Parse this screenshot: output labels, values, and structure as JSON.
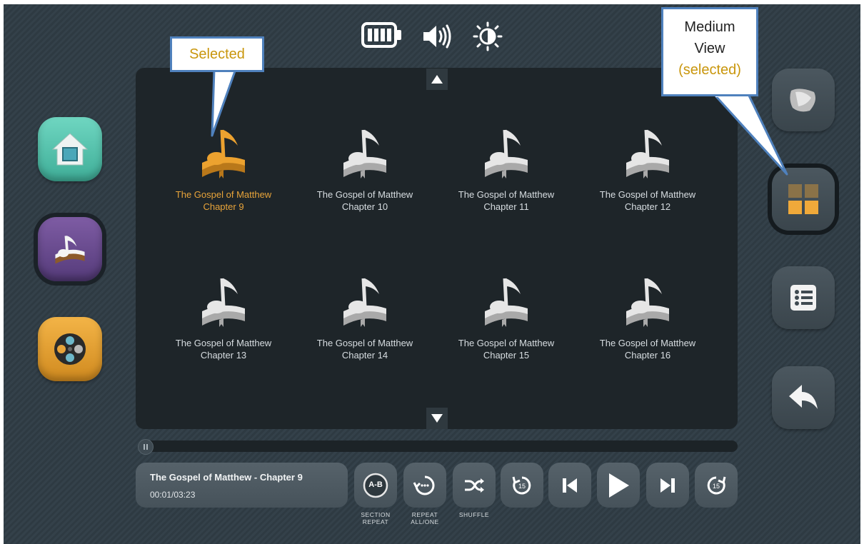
{
  "status_bar": {
    "icons": [
      "battery-icon",
      "volume-icon",
      "brightness-icon"
    ]
  },
  "left_apps": [
    {
      "name": "home-app-button",
      "icon": "home-icon"
    },
    {
      "name": "music-app-button",
      "icon": "music-book-icon",
      "selected": true
    },
    {
      "name": "video-app-button",
      "icon": "film-reel-icon"
    }
  ],
  "grid": {
    "items": [
      {
        "line1": "The Gospel of Matthew",
        "line2": "Chapter 9",
        "selected": true
      },
      {
        "line1": "The Gospel of Matthew",
        "line2": "Chapter 10"
      },
      {
        "line1": "The Gospel of Matthew",
        "line2": "Chapter 11"
      },
      {
        "line1": "The Gospel of Matthew",
        "line2": "Chapter 12"
      },
      {
        "line1": "The Gospel of Matthew",
        "line2": "Chapter 13"
      },
      {
        "line1": "The Gospel of Matthew",
        "line2": "Chapter 14"
      },
      {
        "line1": "The Gospel of Matthew",
        "line2": "Chapter 15"
      },
      {
        "line1": "The Gospel of Matthew",
        "line2": "Chapter 16"
      }
    ]
  },
  "now_playing": {
    "title": "The Gospel of Matthew - Chapter 9",
    "time": "00:01/03:23",
    "progress": 0.005
  },
  "controls": {
    "section_repeat_icon": "A-B",
    "section_repeat_label": "SECTION\nREPEAT",
    "repeat_label": "REPEAT\nALL/ONE",
    "shuffle_label": "SHUFFLE",
    "rewind_badge": "15",
    "forward_badge": "15"
  },
  "callouts": {
    "selected": "Selected",
    "medium_line1": "Medium",
    "medium_line2": "View",
    "medium_line3": "(selected)"
  },
  "colors": {
    "accent": "#e8a43a",
    "callout_border": "#4f81bd",
    "callout_text": "#c9960c"
  }
}
